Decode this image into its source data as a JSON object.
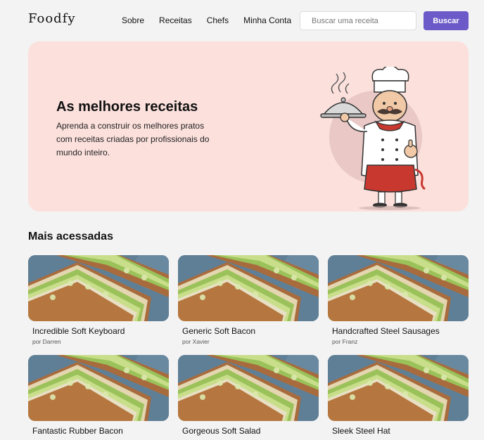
{
  "header": {
    "logo": "Foodfy",
    "nav": [
      "Sobre",
      "Receitas",
      "Chefs",
      "Minha Conta"
    ],
    "search_placeholder": "Buscar uma receita",
    "search_button": "Buscar"
  },
  "hero": {
    "title": "As melhores receitas",
    "text": "Aprenda a construir os melhores pratos com receitas criadas por profissionais do mundo inteiro."
  },
  "section": {
    "title": "Mais acessadas"
  },
  "recipes": [
    {
      "title": "Incredible Soft Keyboard",
      "author": "por Darren"
    },
    {
      "title": "Generic Soft Bacon",
      "author": "por Xavier"
    },
    {
      "title": "Handcrafted Steel Sausages",
      "author": "por Franz"
    },
    {
      "title": "Fantastic Rubber Bacon",
      "author": ""
    },
    {
      "title": "Gorgeous Soft Salad",
      "author": ""
    },
    {
      "title": "Sleek Steel Hat",
      "author": ""
    }
  ],
  "colors": {
    "accent": "#6b5ac8",
    "hero_bg": "#fbe0dc",
    "page_bg": "#f4f3f3"
  },
  "icons": {
    "hero_illustration": "chef-illustration",
    "recipe_image": "sandwich-photo"
  }
}
